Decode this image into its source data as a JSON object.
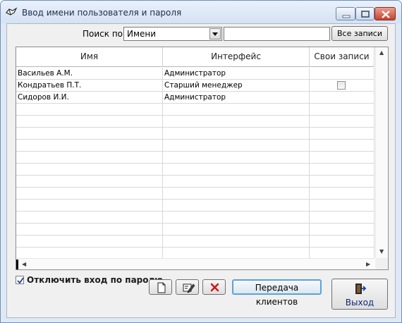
{
  "window": {
    "title": "Ввод имени пользователя и пароля"
  },
  "search": {
    "label": "Поиск по",
    "field_value": "Имени",
    "text_value": "",
    "all_records_label": "Все записи"
  },
  "grid": {
    "columns": [
      "Имя",
      "Интерфейс",
      "Свои записи"
    ],
    "rows": [
      {
        "name": "Васильев А.М.",
        "interface": "Администратор",
        "own_records": null
      },
      {
        "name": "Кондратьев П.Т.",
        "interface": "Старший менеджер",
        "own_records": false
      },
      {
        "name": "Сидоров И.И.",
        "interface": "Администратор",
        "own_records": null
      }
    ]
  },
  "options": {
    "disable_password_login_label": "Отключить вход по паролю",
    "disable_password_login_checked": true
  },
  "toolbar": {
    "transfer_label": "Передача клиентов",
    "exit_label": "Выход"
  },
  "colors": {
    "accent": "#5aa3d8",
    "close_button": "#c7422c",
    "exit_text": "#0a2a7a"
  }
}
